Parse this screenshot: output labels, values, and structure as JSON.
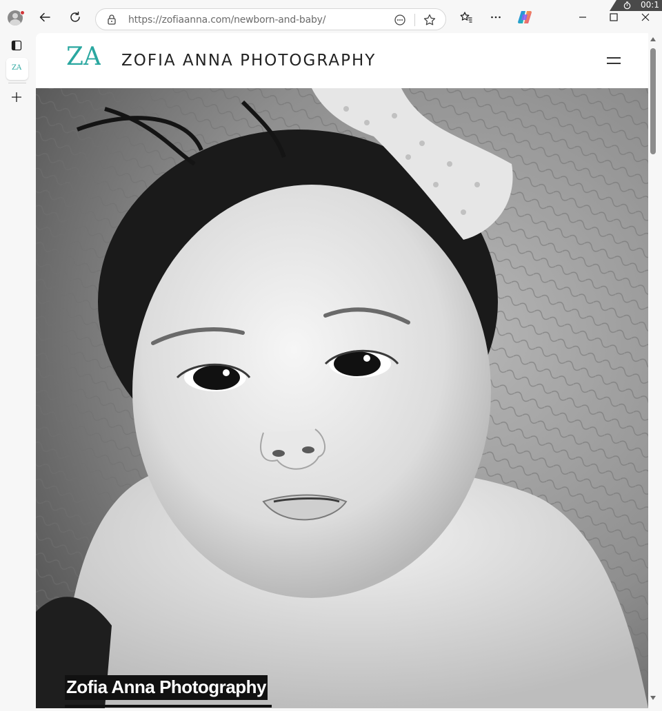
{
  "browser": {
    "url_host": "https://zofiaanna.com",
    "url_path": "/newborn-and-baby/",
    "timer_text": "00:1",
    "icons": [
      "profile-icon",
      "back-icon",
      "refresh-icon",
      "lock-icon",
      "reader-icon",
      "favorite-star-icon",
      "favorites-icon",
      "more-icon",
      "copilot-icon",
      "minimize-icon",
      "maximize-icon",
      "close-icon",
      "vertical-tabs-icon",
      "new-tab-icon"
    ]
  },
  "sidebar": {
    "active_tab_favicon_text": "ZA"
  },
  "site": {
    "logo_text": "ZA",
    "title": "ZOFIA ANNA PHOTOGRAPHY",
    "hero_caption": "Zofia Anna Photography",
    "brand_color": "#2aa7a0"
  }
}
